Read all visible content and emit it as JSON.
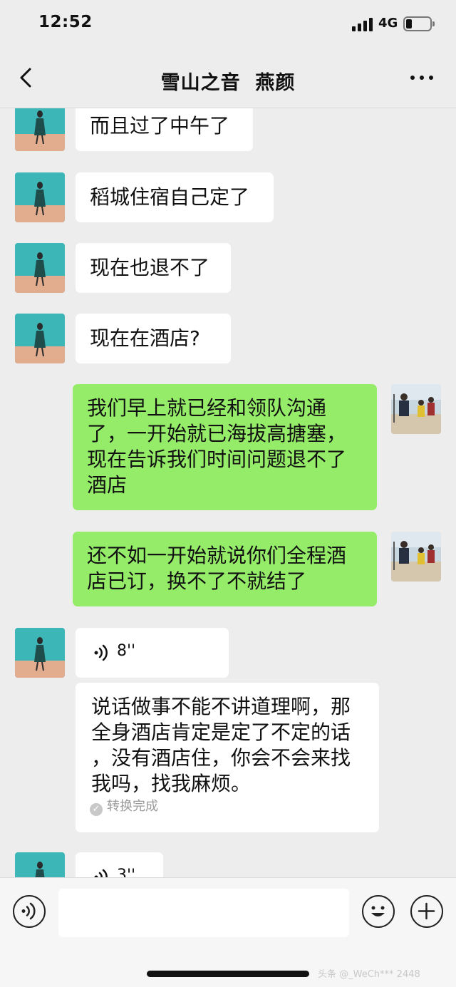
{
  "status_bar": {
    "time": "12:52",
    "network": "4G"
  },
  "header": {
    "title": "雪山之音  燕颜"
  },
  "messages": [
    {
      "text": "而且过了中午了"
    },
    {
      "text": "稻城住宿自己定了"
    },
    {
      "text": "现在也退不了"
    },
    {
      "text": "现在在酒店?"
    },
    {
      "text": "我们早上就已经和领队沟通\n了，一开始就已海拔高搪塞，\n现在告诉我们时间问题退不了\n酒店"
    },
    {
      "text": "还不如一开始就说你们全程酒\n店已订，换不了不就结了"
    },
    {
      "duration": "8''",
      "transcript": "说话做事不能不讲道理啊，那\n全身酒店肯定是定了不定的话\n，没有酒店住，你会不会来找\n我吗，找我麻烦。",
      "transcript_status": "转换完成"
    },
    {
      "duration": "3''"
    }
  ],
  "input": {
    "placeholder": ""
  },
  "watermark": "头条 @_WeCh*** 2448",
  "colors": {
    "background": "#ededed",
    "self_bubble": "#95ec69",
    "other_bubble": "#ffffff"
  }
}
